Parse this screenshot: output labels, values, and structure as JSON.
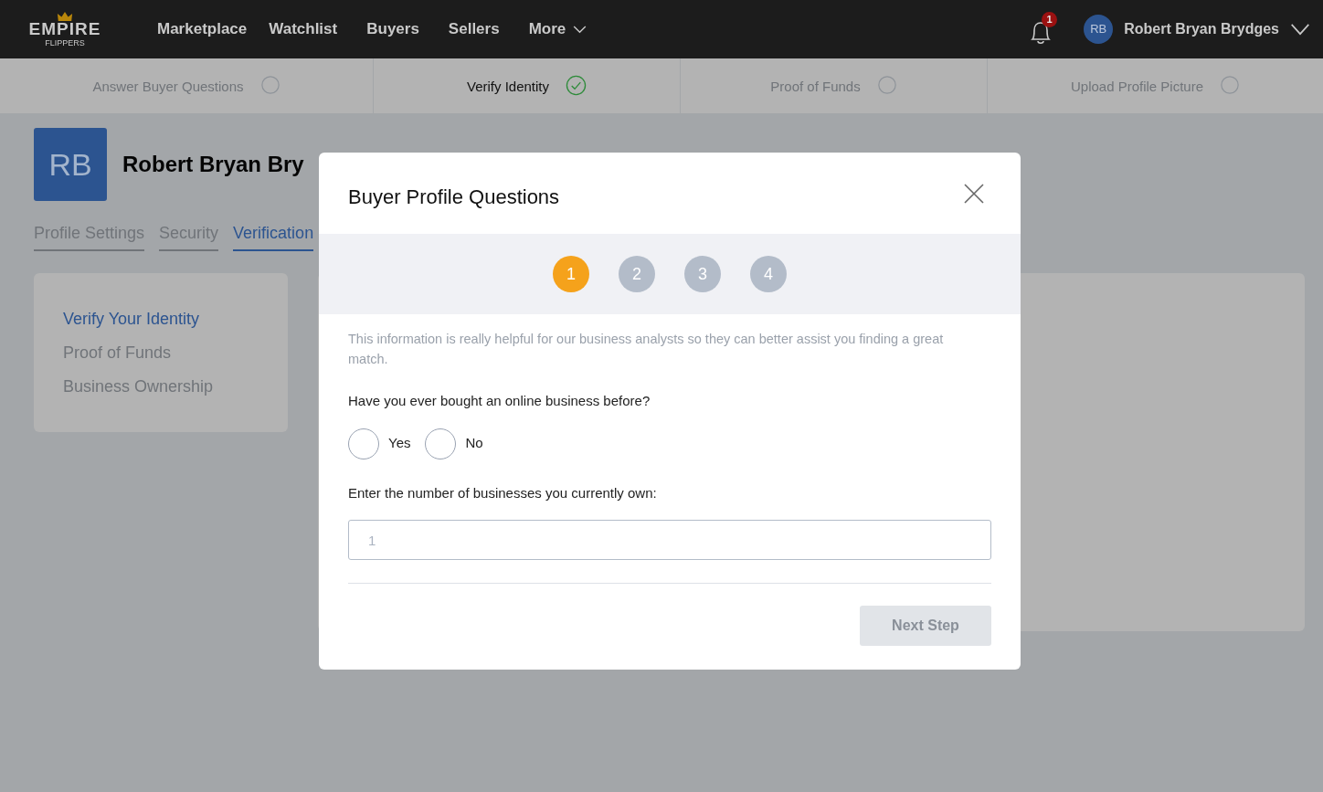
{
  "nav": {
    "logo": {
      "main": "EMPIRE",
      "sub": "FLIPPERS"
    },
    "links": [
      {
        "label": "Marketplace"
      },
      {
        "label": "Watchlist"
      },
      {
        "label": "Buyers"
      },
      {
        "label": "Sellers"
      },
      {
        "label": "More",
        "dropdown": true
      }
    ],
    "notifications": "1",
    "user": {
      "initials": "RB",
      "name": "Robert Bryan Brydges"
    }
  },
  "progress": [
    {
      "label": "Answer Buyer Questions",
      "done": false,
      "selected": false
    },
    {
      "label": "Verify Identity",
      "done": true,
      "selected": true
    },
    {
      "label": "Proof of Funds",
      "done": false,
      "selected": false
    },
    {
      "label": "Upload Profile Picture",
      "done": false,
      "selected": false
    }
  ],
  "profile": {
    "initials": "RB",
    "name": "Robert Bryan Bry"
  },
  "tabs": [
    {
      "label": "Profile Settings",
      "selected": false
    },
    {
      "label": "Security",
      "selected": false
    },
    {
      "label": "Verification",
      "selected": true
    }
  ],
  "sidebar": {
    "items": [
      {
        "label": "Verify Your Identity",
        "selected": true
      },
      {
        "label": "Proof of Funds",
        "selected": false
      },
      {
        "label": "Business Ownership",
        "selected": false
      }
    ]
  },
  "modal": {
    "title": "Buyer Profile Questions",
    "steps": [
      {
        "label": "1",
        "selected": true
      },
      {
        "label": "2",
        "selected": false
      },
      {
        "label": "3",
        "selected": false
      },
      {
        "label": "4",
        "selected": false
      }
    ],
    "intro": "This information is really helpful for our business analysts so they can better assist you finding a great match.",
    "question": "Have you ever bought an online business before?",
    "options": [
      {
        "label": "Yes",
        "checked": false
      },
      {
        "label": "No",
        "checked": false
      }
    ],
    "count_label": "Enter the number of businesses you currently own:",
    "count_field": {
      "placeholder": "1"
    },
    "next_button": {
      "label": "Next Step",
      "disabled": true
    }
  }
}
